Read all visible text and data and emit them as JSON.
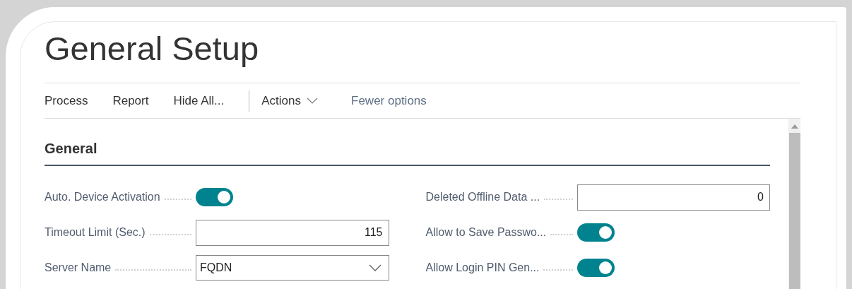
{
  "page": {
    "title": "General Setup"
  },
  "actions": [
    {
      "label": "Process",
      "kind": "button",
      "separator_before": false
    },
    {
      "label": "Report",
      "kind": "button",
      "separator_before": false
    },
    {
      "label": "Hide All...",
      "kind": "button",
      "separator_before": false
    },
    {
      "label": "Actions",
      "kind": "menu",
      "separator_before": true
    },
    {
      "label": "Fewer options",
      "kind": "link",
      "separator_before": false
    }
  ],
  "section": {
    "title": "General"
  },
  "columns": [
    [
      {
        "label": "Auto. Device Activation",
        "kind": "toggle",
        "on": true
      },
      {
        "label": "Timeout Limit (Sec.)",
        "kind": "number",
        "value": "115"
      },
      {
        "label": "Server Name",
        "kind": "select",
        "value": "FQDN"
      }
    ],
    [
      {
        "label": "Deleted Offline Data ...",
        "kind": "number",
        "value": "0"
      },
      {
        "label": "Allow to Save Passwo...",
        "kind": "toggle",
        "on": true
      },
      {
        "label": "Allow Login PIN Gen...",
        "kind": "toggle",
        "on": true
      }
    ]
  ]
}
